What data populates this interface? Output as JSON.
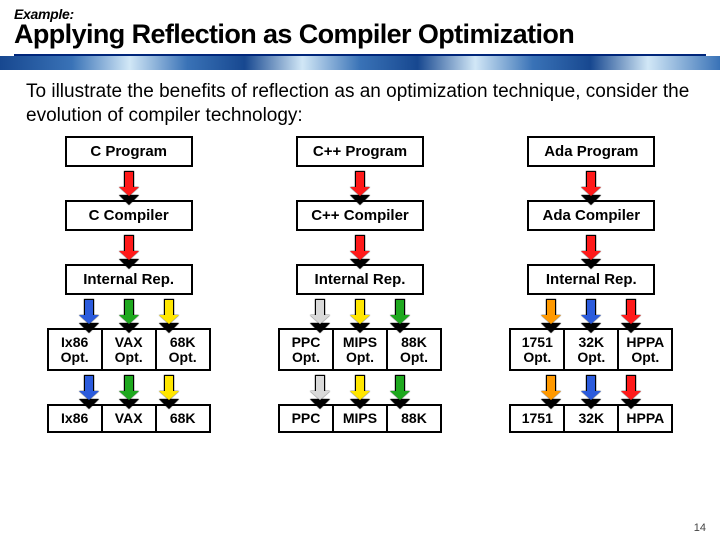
{
  "header": {
    "pretitle": "Example:",
    "title": "Applying Reflection as Compiler Optimization"
  },
  "intro": "To illustrate the benefits of reflection as an optimization technique, consider the evolution of compiler technology:",
  "columns": [
    {
      "program": "C Program",
      "compiler": "C Compiler",
      "ir": "Internal Rep.",
      "opts": [
        "Ix86 Opt.",
        "VAX Opt.",
        "68K Opt."
      ],
      "targets": [
        "Ix86",
        "VAX",
        "68K"
      ],
      "arrow_colors": [
        "blue",
        "green",
        "yellow"
      ]
    },
    {
      "program": "C++ Program",
      "compiler": "C++ Compiler",
      "ir": "Internal Rep.",
      "opts": [
        "PPC Opt.",
        "MIPS Opt.",
        "88K Opt."
      ],
      "targets": [
        "PPC",
        "MIPS",
        "88K"
      ],
      "arrow_colors": [
        "grey",
        "yellow",
        "green"
      ]
    },
    {
      "program": "Ada Program",
      "compiler": "Ada Compiler",
      "ir": "Internal Rep.",
      "opts": [
        "1751 Opt.",
        "32K Opt.",
        "HPPA Opt."
      ],
      "targets": [
        "1751",
        "32K",
        "HPPA"
      ],
      "arrow_colors": [
        "orange",
        "blue",
        "red"
      ]
    }
  ],
  "page_number": "14"
}
